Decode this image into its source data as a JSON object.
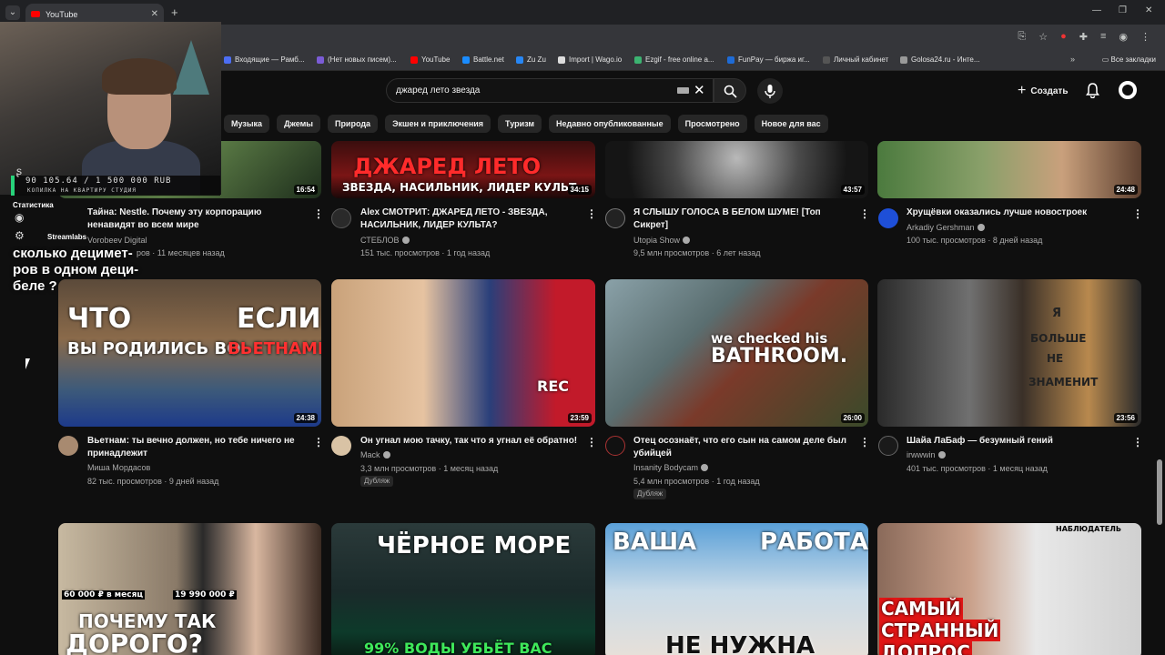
{
  "browser": {
    "tab_title": "YouTube",
    "new_tab_icon": "+",
    "bookmarks": [
      {
        "label": "Входящие — Рамб...",
        "color": "#4c6ef5"
      },
      {
        "label": "(Нет новых писем)...",
        "color": "#7b5cd6"
      },
      {
        "label": "YouTube",
        "color": "#ff0000"
      },
      {
        "label": "Battle.net",
        "color": "#1a8cff"
      },
      {
        "label": "Zu Zu",
        "color": "#2787f5"
      },
      {
        "label": "Import | Wago.io",
        "color": "#dddddd"
      },
      {
        "label": "Ezgif - free online a...",
        "color": "#3cb371"
      },
      {
        "label": "FunPay — биржа иг...",
        "color": "#1e6bd6"
      },
      {
        "label": "Личный кабинет",
        "color": "#555555"
      },
      {
        "label": "Golosa24.ru - Инте...",
        "color": "#999999"
      }
    ],
    "all_bookmarks": "Все закладки"
  },
  "youtube": {
    "search_value": "джаред лето звезда",
    "create_label": "Создать",
    "chips": [
      "Музыка",
      "Джемы",
      "Природа",
      "Экшен и приключения",
      "Туризм",
      "Недавно опубликованные",
      "Просмотрено",
      "Новое для вас"
    ],
    "rows": [
      [
        {
          "title": "Тайна: Nestle. Почему эту корпорацию ненавидят во всем мире",
          "channel": "Vorobeev Digital",
          "stats": "ров · 11 месяцев назад",
          "duration": "16:54",
          "verified": false
        },
        {
          "title": "Alex СМОТРИТ: ДЖАРЕД ЛЕТО - ЗВЕЗДА, НАСИЛЬНИК, ЛИДЕР КУЛЬТА?",
          "channel": "СТЕБЛОВ",
          "stats": "151 тыс. просмотров · 1 год назад",
          "duration": "34:15",
          "verified": true,
          "overlay1": "ДЖАРЕД ЛЕТО",
          "overlay2": "ЗВЕЗДА, НАСИЛЬНИК, ЛИДЕР КУЛЬТ..."
        },
        {
          "title": "Я СЛЫШУ ГОЛОСА В БЕЛОМ ШУМЕ! [Топ Сикрет]",
          "channel": "Utopia Show",
          "stats": "9,5 млн просмотров · 6 лет назад",
          "duration": "43:57",
          "verified": true
        },
        {
          "title": "Хрущёвки оказались лучше новостроек",
          "channel": "Arkadiy Gershman",
          "stats": "100 тыс. просмотров · 8 дней назад",
          "duration": "24:48",
          "verified": true
        }
      ],
      [
        {
          "title": "Вьетнам: ты вечно должен, но тебе ничего не принадлежит",
          "channel": "Миша Мордасов",
          "stats": "82 тыс. просмотров · 9 дней назад",
          "duration": "24:38",
          "verified": false,
          "overlay1": "ЧТО",
          "overlay2": "ЕСЛИ",
          "overlay3": "ВЫ РОДИЛИСЬ ВО",
          "overlay4": "ВЬЕТНАМЕ"
        },
        {
          "title": "Он угнал мою тачку, так что я угнал её обратно!",
          "channel": "Mack",
          "stats": "3,3 млн просмотров · 1 месяц назад",
          "duration": "23:59",
          "verified": true,
          "badge": "Дубляж",
          "overlay1": "REC"
        },
        {
          "title": "Отец осознаёт, что его сын на самом деле был убийцей",
          "channel": "Insanity Bodycam",
          "stats": "5,4 млн просмотров · 1 год назад",
          "duration": "26:00",
          "verified": true,
          "badge": "Дубляж",
          "overlay1": "we checked his",
          "overlay2": "BATHROOM."
        },
        {
          "title": "Шайа ЛаБаф — безумный гений",
          "channel": "irwwwin",
          "stats": "401 тыс. просмотров · 1 месяц назад",
          "duration": "23:56",
          "verified": true,
          "overlay1": "Я",
          "overlay2": "БОЛЬШЕ",
          "overlay3": "НЕ",
          "overlay4": "ЗНАМЕНИТ"
        }
      ],
      [
        {
          "overlay1": "60 000 ₽ в месяц",
          "overlay2": "19 990 000 ₽",
          "overlay3": "ПОЧЕМУ ТАК",
          "overlay4": "ДОРОГО?"
        },
        {
          "overlay1": "ЧЁРНОЕ МОРЕ",
          "overlay2": "99% ВОДЫ УБЬЁТ ВАС"
        },
        {
          "overlay1": "ВАША",
          "overlay2": "РАБОТА",
          "overlay3": "НЕ НУЖНА"
        },
        {
          "overlay1": "НАБЛЮДАТЕЛЬ",
          "overlay2": "САМЫЙ",
          "overlay3": "СТРАННЫЙ",
          "overlay4": "ДОПРОС"
        }
      ]
    ]
  },
  "stream_overlay": {
    "goal_amount": "90 105.64 / 1 500 000 RUB",
    "goal_caption": "КОПИЛКА НА КВАРТИРУ СТУДИЯ",
    "stats_label": "Статистика",
    "streamlabs": "Streamlabs",
    "question": "сколько децимет-\nров в одном деци-\nбеле ?"
  }
}
